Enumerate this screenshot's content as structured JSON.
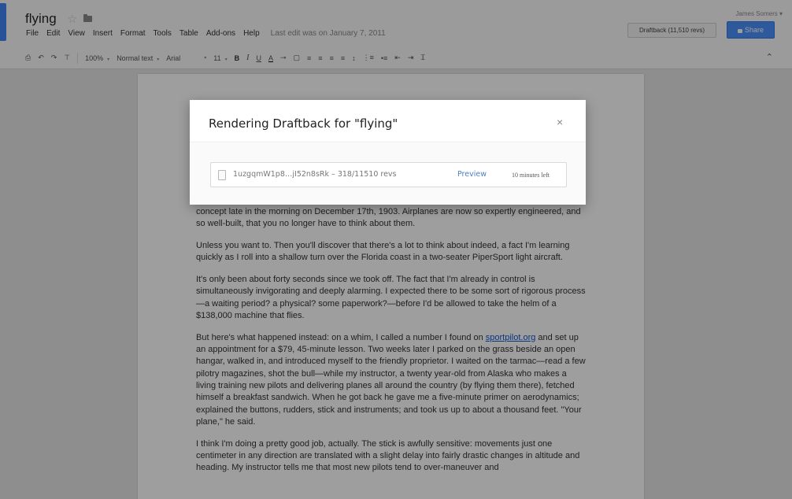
{
  "document": {
    "title": "flying",
    "last_edit": "Last edit was on January 7, 2011"
  },
  "menu": [
    "File",
    "Edit",
    "View",
    "Insert",
    "Format",
    "Tools",
    "Table",
    "Add-ons",
    "Help"
  ],
  "account": {
    "user_name": "James Somers",
    "draftback_label": "Draftback (11,510 revs)",
    "share_label": "Share"
  },
  "toolbar": {
    "zoom": "100%",
    "style": "Normal text",
    "font": "Arial",
    "size": "11",
    "bold": "B",
    "italic": "I",
    "underline": "U",
    "text_color": "A"
  },
  "modal": {
    "title": "Rendering Draftback for \"flying\"",
    "close": "×",
    "file_name": "1uzgqmW1p8…jI52n8sRk – 318/11510 revs",
    "preview": "Preview",
    "time_left": "10 minutes left"
  },
  "body": {
    "p1": "concept late in the morning on December 17th, 1903. Airplanes are now so expertly engineered, and so well-built, that you no longer have to think about them.",
    "p2": "Unless you want to. Then you'll discover that there's a lot to think about indeed, a fact I'm learning quickly as I roll into a shallow turn over the Florida coast in a two-seater PiperSport light aircraft.",
    "p3": "It's only been about forty seconds since we took off. The fact that I'm already in control is simultaneously invigorating and deeply alarming. I expected there to be some sort of rigorous process—a waiting period? a physical? some paperwork?—before I'd be allowed to take the helm of a $138,000 machine that flies.",
    "p4_before_link": "But here's what happened instead: on a whim, I called a number I found on ",
    "p4_link": "sportpilot.org",
    "p4_after_link": " and set up an appointment for a $79, 45-minute lesson. Two weeks later I parked on the grass beside an open hangar, walked in, and introduced myself to the friendly proprietor. I waited on the tarmac—read a few pilotry magazines, shot the bull—while my instructor, a twenty year-old from Alaska who makes a living training new pilots and delivering planes all around the country (by flying them there), fetched himself a breakfast sandwich. When he got back he gave me a five-minute primer on aerodynamics; explained the buttons, rudders, stick and instruments; and took us up to about a thousand feet. \"Your plane,\" he said.",
    "p5": "I think I'm doing a pretty good job, actually. The stick is awfully sensitive: movements just one centimeter in any direction are translated with a slight delay into fairly drastic changes in altitude and heading. My instructor tells me that most new pilots tend to over-maneuver and"
  },
  "colors": {
    "accent": "#4d90fe",
    "docs_blue": "#4285f4",
    "link": "#1155cc"
  }
}
